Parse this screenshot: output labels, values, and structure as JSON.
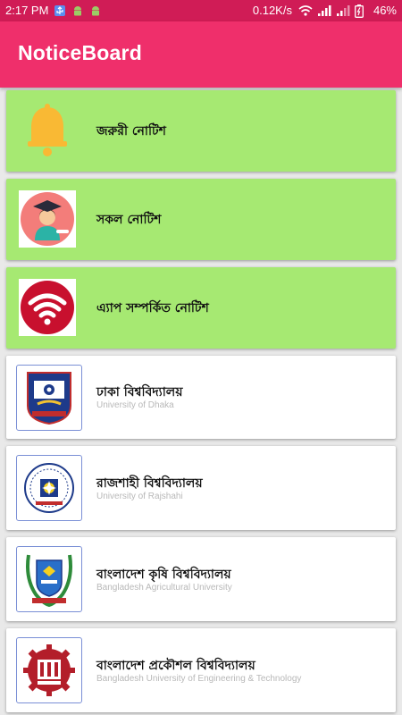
{
  "status_bar": {
    "time": "2:17 PM",
    "speed": "0.12K/s",
    "battery": "46%"
  },
  "app_bar": {
    "title": "NoticeBoard"
  },
  "colors": {
    "status_bar": "#d01c56",
    "app_bar": "#ef2f6b",
    "highlight_card": "#a6e972",
    "card": "#ffffff"
  },
  "cards": [
    {
      "title": "জরুরী নোটিশ",
      "icon": "bell-icon"
    },
    {
      "title": "সকল নোটিশ",
      "icon": "graduate-icon"
    },
    {
      "title": "এ্যাপ সম্পর্কিত নোটিশ",
      "icon": "wifi-icon"
    },
    {
      "title": "ঢাকা বিশ্ববিদ্যালয়",
      "subtitle": "University of Dhaka",
      "icon": "dhaka-university-logo"
    },
    {
      "title": "রাজশাহী বিশ্ববিদ্যালয়",
      "subtitle": "University of Rajshahi",
      "icon": "rajshahi-university-logo"
    },
    {
      "title": "বাংলাদেশ কৃষি বিশ্ববিদ্যালয়",
      "subtitle": "Bangladesh Agricultural University",
      "icon": "bau-logo"
    },
    {
      "title": "বাংলাদেশ প্রকৌশল বিশ্ববিদ্যালয়",
      "subtitle": "Bangladesh University of Engineering & Technology",
      "icon": "buet-logo"
    }
  ]
}
